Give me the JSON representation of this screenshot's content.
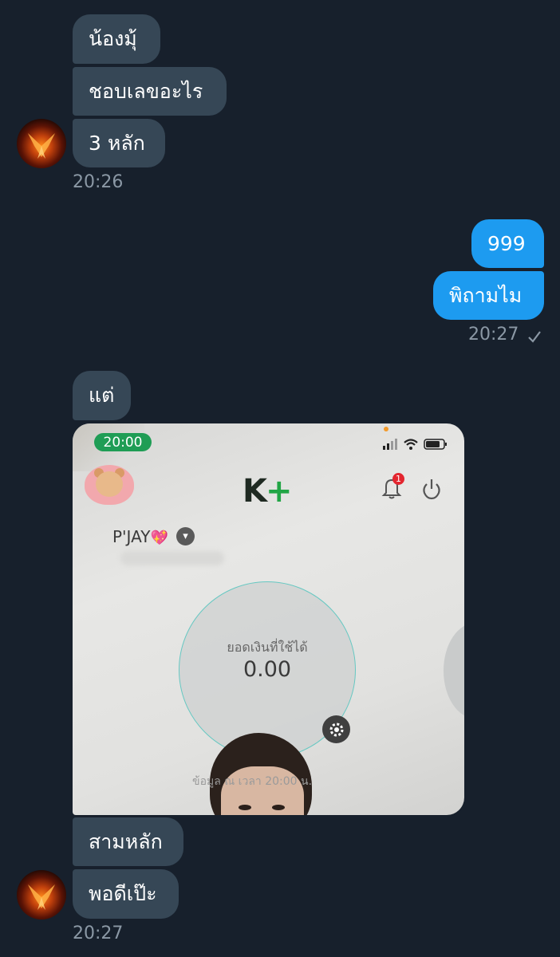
{
  "messages": {
    "in1": "น้องมุ้",
    "in2": "ชอบเลขอะไร",
    "in3": "3 หลัก",
    "time1": "20:26",
    "out1": "999",
    "out2": "พิถามไม",
    "time2": "20:27",
    "in4": "แต่",
    "in5": "สามหลัก",
    "in6": "พอดีเป๊ะ",
    "time3": "20:27"
  },
  "screenshot": {
    "clock": "20:00",
    "logo_k": "K",
    "logo_plus": "+",
    "notification_count": "1",
    "username": "P'JAY",
    "balance_label": "ยอดเงินที่ใช้ได้",
    "balance": "0.00",
    "data_as_of": "ข้อมูล ณ เวลา 20:00 น."
  },
  "colors": {
    "background": "#17202c",
    "incoming_bubble": "#364756",
    "outgoing_bubble": "#1d9bf0",
    "timestamp": "#8b98a5"
  }
}
